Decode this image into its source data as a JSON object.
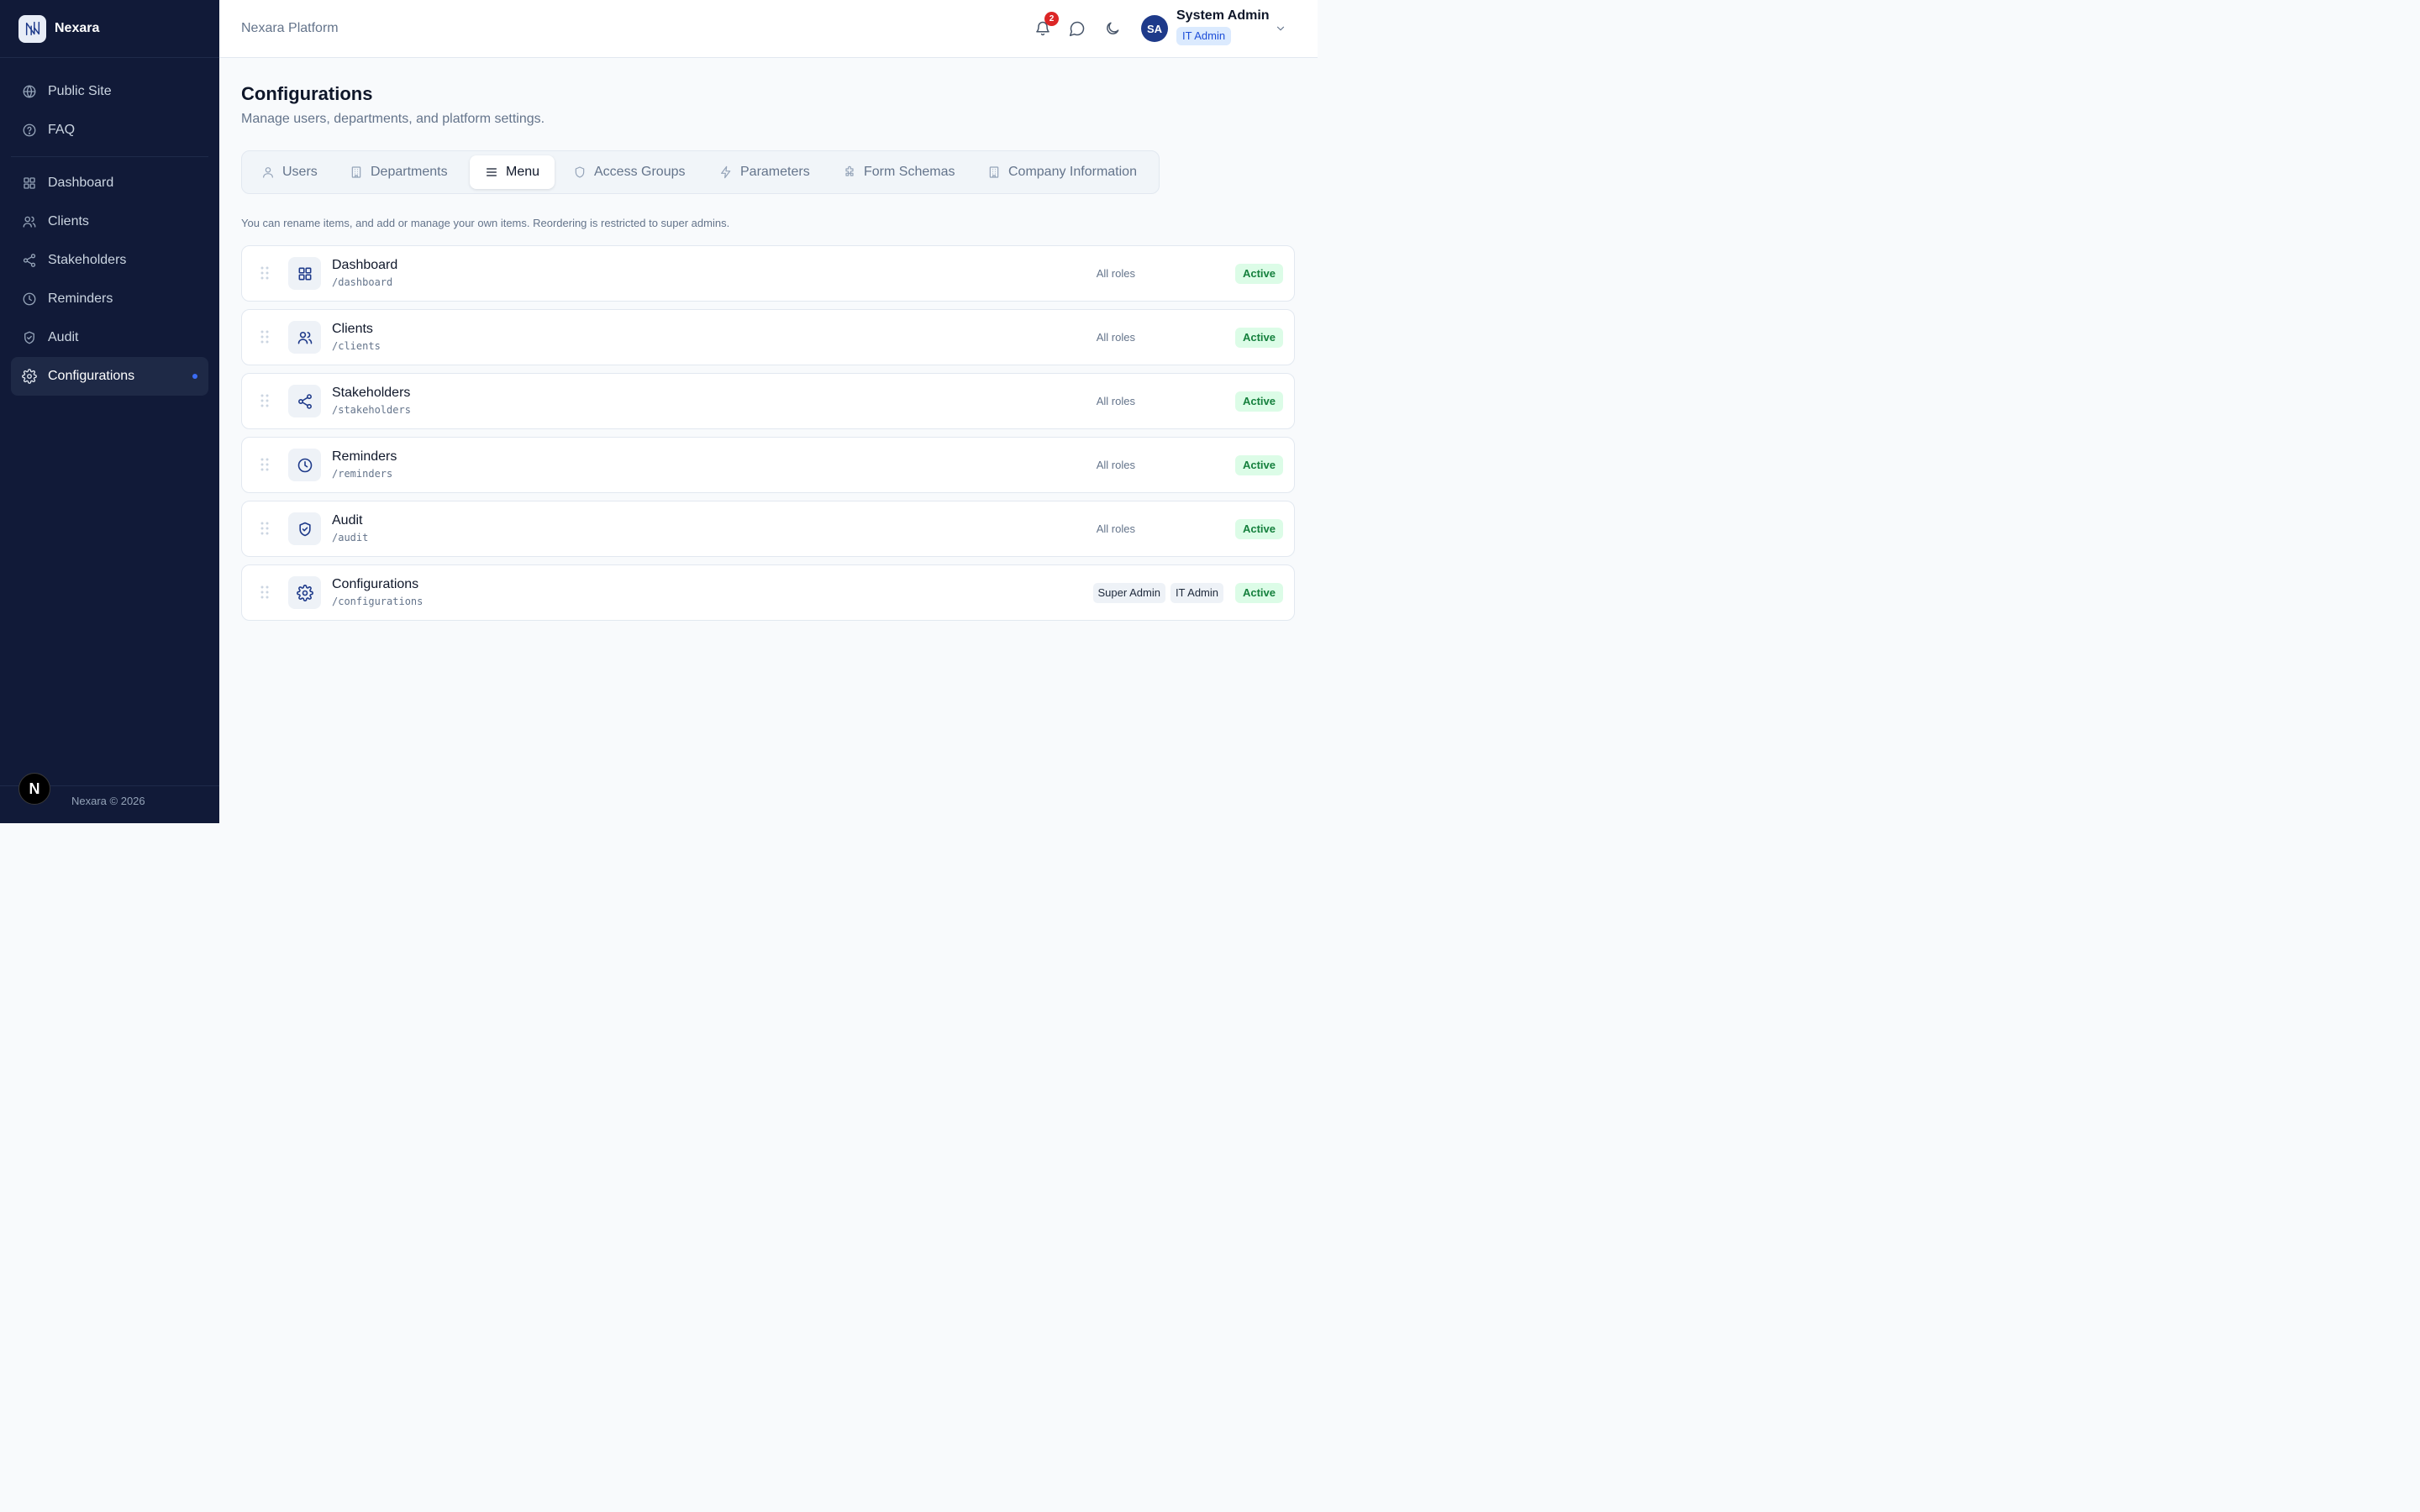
{
  "brand": {
    "name": "Nexara"
  },
  "sidebar": {
    "group1": [
      {
        "label": "Public Site",
        "icon": "globe-icon"
      },
      {
        "label": "FAQ",
        "icon": "help-circle-icon"
      }
    ],
    "group2": [
      {
        "label": "Dashboard",
        "icon": "grid-icon"
      },
      {
        "label": "Clients",
        "icon": "users-icon"
      },
      {
        "label": "Stakeholders",
        "icon": "share-icon"
      },
      {
        "label": "Reminders",
        "icon": "clock-icon"
      },
      {
        "label": "Audit",
        "icon": "shield-check-icon"
      },
      {
        "label": "Configurations",
        "icon": "gear-icon",
        "active": true
      }
    ],
    "footer": "Nexara © 2026",
    "badge": "N"
  },
  "header": {
    "title": "Nexara Platform",
    "notifications": "2",
    "user": {
      "initials": "SA",
      "name": "System Admin",
      "role": "IT Admin"
    }
  },
  "main": {
    "title": "Configurations",
    "subtitle": "Manage users, departments, and platform settings.",
    "tabs": [
      {
        "label": "Users",
        "icon": "user-icon"
      },
      {
        "label": "Departments",
        "icon": "building-icon"
      },
      {
        "label": "Menu",
        "icon": "menu-icon",
        "active": true
      },
      {
        "label": "Access Groups",
        "icon": "shield-icon"
      },
      {
        "label": "Parameters",
        "icon": "zap-icon"
      },
      {
        "label": "Form Schemas",
        "icon": "puzzle-icon"
      },
      {
        "label": "Company Information",
        "icon": "building-icon"
      }
    ],
    "hint": "You can rename items, and add or manage your own items. Reordering is restricted to super admins.",
    "items": [
      {
        "name": "Dashboard",
        "path": "/dashboard",
        "roles": "All roles",
        "status": "Active",
        "icon": "grid-icon"
      },
      {
        "name": "Clients",
        "path": "/clients",
        "roles": "All roles",
        "status": "Active",
        "icon": "users-icon"
      },
      {
        "name": "Stakeholders",
        "path": "/stakeholders",
        "roles": "All roles",
        "status": "Active",
        "icon": "share-icon"
      },
      {
        "name": "Reminders",
        "path": "/reminders",
        "roles": "All roles",
        "status": "Active",
        "icon": "clock-icon"
      },
      {
        "name": "Audit",
        "path": "/audit",
        "roles": "All roles",
        "status": "Active",
        "icon": "shield-check-icon"
      },
      {
        "name": "Configurations",
        "path": "/configurations",
        "role_chips": [
          "Super Admin",
          "IT Admin"
        ],
        "status": "Active",
        "icon": "gear-icon"
      }
    ]
  },
  "colors": {
    "sidebar_bg": "#111a38",
    "accent": "#1e3a8a",
    "active_status": "#15803d",
    "notification": "#dc2626"
  }
}
